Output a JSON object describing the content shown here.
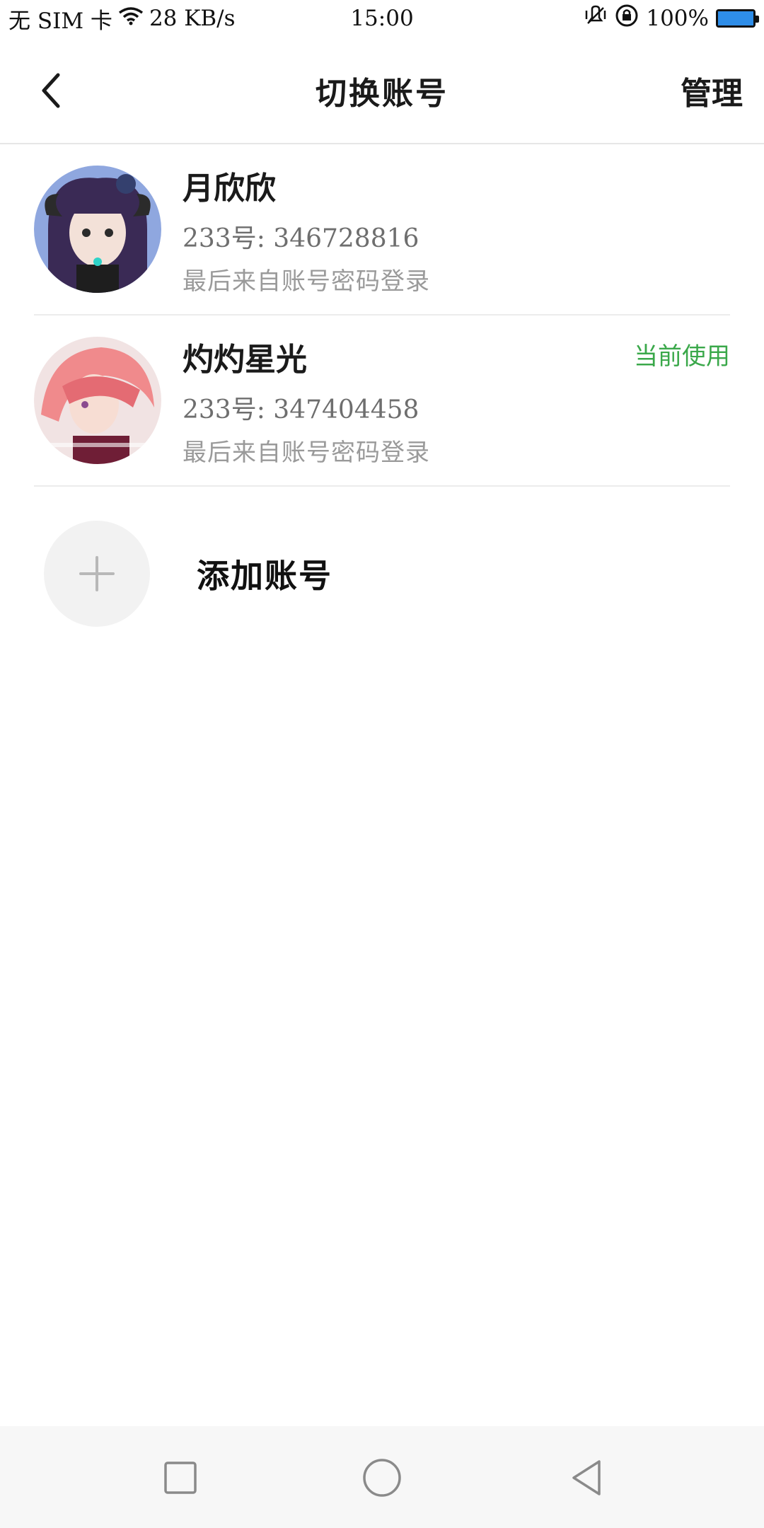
{
  "status_bar": {
    "sim": "无 SIM 卡",
    "speed": "28 KB/s",
    "time": "15:00",
    "battery_text": "100%",
    "battery_level": 1.0,
    "icons": [
      "wifi-icon",
      "vibrate-icon",
      "rotation-lock-icon",
      "battery-icon"
    ],
    "battery_color": "#2e8de8"
  },
  "header": {
    "title": "切换账号",
    "manage_label": "管理",
    "back_icon": "chevron-left-icon"
  },
  "accounts": [
    {
      "name": "月欣欣",
      "id": "233号: 346728816",
      "login": "最后来自账号密码登录",
      "current": "",
      "avatar_icon": "avatar-icon"
    },
    {
      "name": "灼灼星光",
      "id": "233号: 347404458",
      "login": "最后来自账号密码登录",
      "current": "当前使用",
      "avatar_icon": "avatar-icon"
    }
  ],
  "add_account": {
    "label": "添加账号",
    "icon": "plus-icon"
  },
  "colors": {
    "accent_green": "#3aa84a",
    "divider": "#e6e6e6",
    "secondary_text": "#9a9a9a"
  },
  "nav_bar": {
    "icons": [
      "recents-square-icon",
      "home-circle-icon",
      "back-triangle-icon"
    ]
  }
}
